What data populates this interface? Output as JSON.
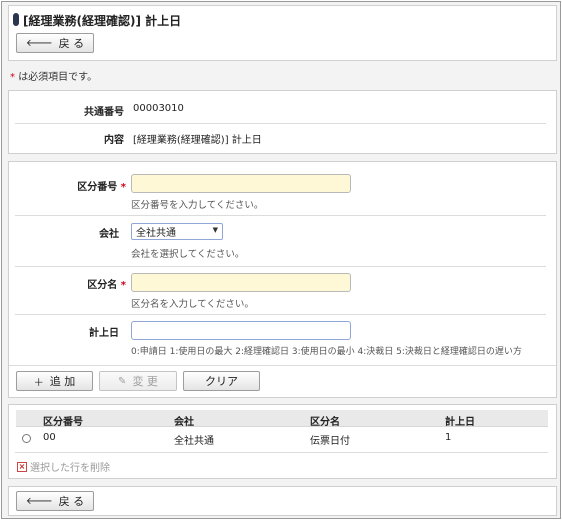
{
  "header": {
    "title": "[経理業務(経理確認)] 計上日"
  },
  "buttons": {
    "back": "戻 る",
    "add": "追 加",
    "change": "変 更",
    "clear": "クリア"
  },
  "required_note": {
    "star": "*",
    "text": "は必須項目です。"
  },
  "info": {
    "common_no_label": "共通番号",
    "common_no_value": "00003010",
    "content_label": "内容",
    "content_value": "[経理業務(経理確認)] 計上日"
  },
  "form": {
    "division_no": {
      "label": "区分番号",
      "value": "",
      "hint": "区分番号を入力してください。"
    },
    "company": {
      "label": "会社",
      "selected": "全社共通",
      "hint": "会社を選択してください。"
    },
    "division_name": {
      "label": "区分名",
      "value": "",
      "hint": "区分名を入力してください。"
    },
    "booking_date": {
      "label": "計上日",
      "value": "",
      "hint": "0:申請日 1:使用日の最大 2:経理確認日 3:使用日の最小 4:決裁日 5:決裁日と経理確認日の遅い方"
    },
    "required_star": "*"
  },
  "table": {
    "headers": [
      "区分番号",
      "会社",
      "区分名",
      "計上日"
    ],
    "rows": [
      {
        "division_no": "00",
        "company": "全社共通",
        "division_name": "伝票日付",
        "booking_date": "1"
      }
    ],
    "delete_label": "選択した行を削除"
  },
  "icons": {
    "back": "arrow-left-icon",
    "add": "plus-icon",
    "change": "pencil-icon",
    "delete": "x-box-icon"
  },
  "colors": {
    "required": "#d0021b",
    "input_required_bg": "#fff8d6",
    "title_mark": "#2b3550"
  }
}
